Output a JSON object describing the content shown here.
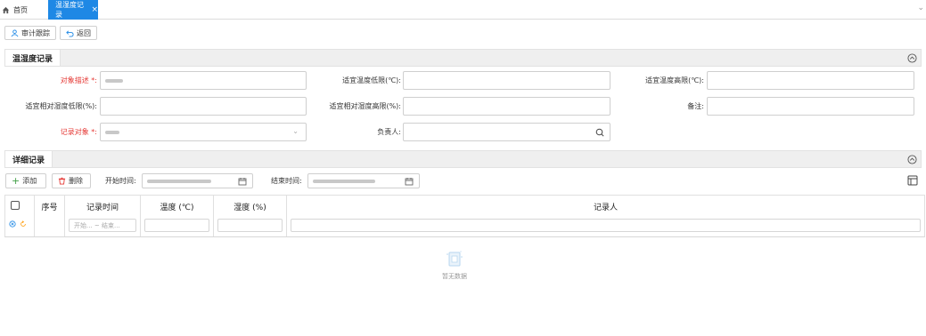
{
  "tabs": {
    "home_label": "首页",
    "active_label": "温湿度记录",
    "close_glyph": "×",
    "more_glyph": "⌄"
  },
  "toolbar": {
    "audit_label": "审计跟踪",
    "back_label": "返回"
  },
  "section1": {
    "title": "温湿度记录"
  },
  "form": {
    "object_desc_label": "对象描述 *:",
    "temp_low_label": "适宜温度低限(℃):",
    "temp_high_label": "适宜温度高限(℃):",
    "rh_low_label": "适宜相对湿度低限(%):",
    "rh_high_label": "适宜相对湿度高限(%):",
    "remark_label": "备注:",
    "record_object_label": "记录对象 *:",
    "owner_label": "负责人:"
  },
  "section2": {
    "title": "详细记录"
  },
  "detail_toolbar": {
    "add_label": "添加",
    "delete_label": "删除",
    "start_label": "开始时间:",
    "end_label": "结束时间:"
  },
  "grid": {
    "columns": [
      "序号",
      "记录时间",
      "温度 (℃)",
      "湿度 (%)",
      "记录人"
    ],
    "time_filter_placeholder": "开始... ~ 结束..."
  },
  "empty_text": "暂无数据",
  "colors": {
    "accent": "#1e88e5",
    "required": "#e53935",
    "delete": "#e53935",
    "add": "#43a047"
  }
}
